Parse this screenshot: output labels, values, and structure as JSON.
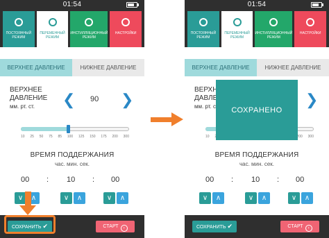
{
  "time": "01:54",
  "modes": [
    {
      "label": "ПОСТОЯННЫЙ РЕЖИМ",
      "icon": "target-icon",
      "style": "teal"
    },
    {
      "label": "ПЕРЕМЕННЫЙ РЕЖИМ",
      "icon": "dial-icon",
      "style": "white"
    },
    {
      "label": "ИНСТИЛЛЯЦИОННЫЙ РЕЖИМ",
      "icon": "drop-icon",
      "style": "green"
    },
    {
      "label": "НАСТРОЙКИ",
      "icon": "gear-icon",
      "style": "red"
    }
  ],
  "tabs": {
    "upper": "ВЕРХНЕЕ ДАВЛЕНИЕ",
    "lower": "НИЖНЕЕ ДАВЛЕНИЕ"
  },
  "pressure": {
    "label_line1": "ВЕРХНЕЕ",
    "label_line2": "ДАВЛЕНИЕ",
    "unit": "мм. рт. ст.",
    "value": "90"
  },
  "slider": {
    "ticks": [
      "10",
      "25",
      "50",
      "75",
      "85",
      "100",
      "125",
      "150",
      "175",
      "200",
      "300"
    ],
    "value": 90,
    "min": 10,
    "max": 300
  },
  "hold": {
    "title": "ВРЕМЯ ПОДДЕРЖАНИЯ",
    "units": "час. мин. сек.",
    "hours": "00",
    "minutes": "10",
    "seconds": "00"
  },
  "buttons": {
    "save": "СОХРАНИТЬ",
    "start": "СТАРТ"
  },
  "modal": {
    "text": "СОХРАНЕНО"
  },
  "colors": {
    "accent": "#2a9c97",
    "highlight": "#f07f2c",
    "start": "#f06474",
    "blue": "#2a88c6"
  }
}
